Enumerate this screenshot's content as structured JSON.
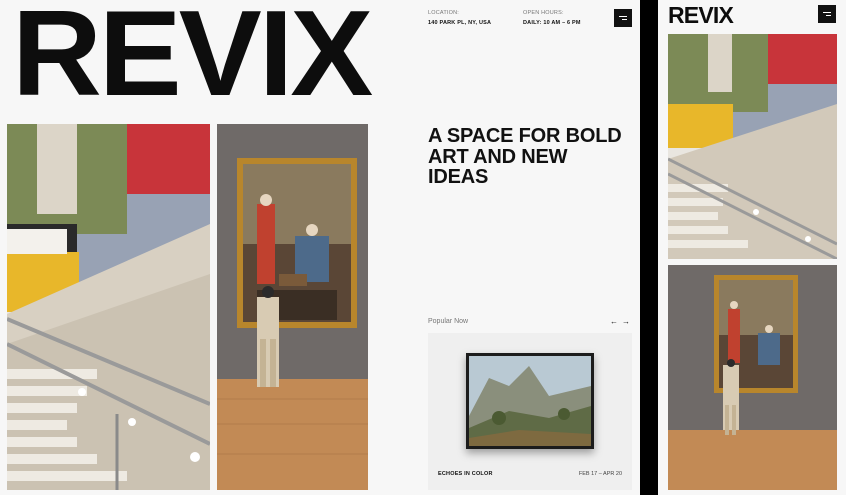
{
  "brand": {
    "name": "REVIX"
  },
  "info": {
    "location_label": "LOCATION:",
    "location_value": "140 PARK PL, NY, USA",
    "hours_label": "OPEN HOURS:",
    "hours_value": "DAILY: 10 AM – 6 PM"
  },
  "hero": {
    "headline": "A SPACE FOR BOLD ART AND NEW IDEAS"
  },
  "popular": {
    "title": "Popular Now",
    "prev_icon": "arrow-left-icon",
    "next_icon": "arrow-right-icon",
    "prev": "←",
    "next": "→",
    "card": {
      "title": "ECHOES IN COLOR",
      "dates": "FEB 17 – APR 20"
    }
  },
  "icons": {
    "menu": "menu-icon"
  },
  "colors": {
    "red": "#c8343a",
    "olive": "#7c8a56",
    "yellow": "#e8b72a",
    "blue_gray": "#98a2b4",
    "floor": "#c28a55",
    "gallery_wall": "#6f6a68",
    "gold_frame": "#b8862c"
  }
}
